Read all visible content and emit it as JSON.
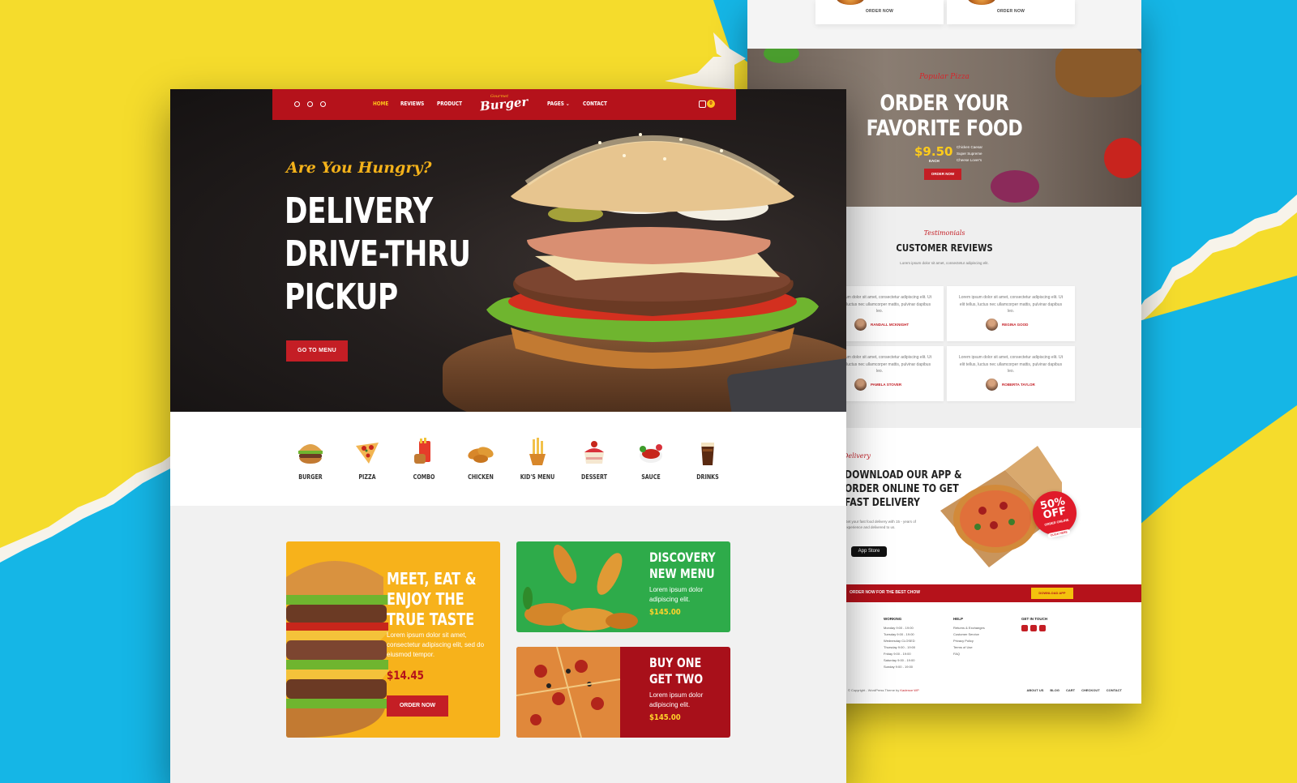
{
  "colors": {
    "brand_red": "#b5121b",
    "accent_yellow": "#ffc21a",
    "bg_yellow": "#f5dc2c",
    "bg_blue": "#15b6e6",
    "promo_yellow": "#f7b21b",
    "promo_green": "#2eab4a",
    "promo_red": "#a8101a"
  },
  "front": {
    "nav": {
      "social_icons": [
        "facebook-icon",
        "twitter-icon",
        "instagram-icon"
      ],
      "links_left": [
        "HOME",
        "REVIEWS",
        "PRODUCT"
      ],
      "links_right": [
        "PAGES",
        "CONTACT"
      ],
      "active": "HOME",
      "logo_top": "Gourmet",
      "logo_main": "Burger",
      "cart_count": "0"
    },
    "hero": {
      "kicker": "Are You Hungry?",
      "headline": [
        "DELIVERY",
        "DRIVE-THRU",
        "PICKUP"
      ],
      "button": "GO TO MENU"
    },
    "categories": [
      {
        "label": "BURGER",
        "icon": "burger-icon"
      },
      {
        "label": "PIZZA",
        "icon": "pizza-icon"
      },
      {
        "label": "COMBO",
        "icon": "combo-icon"
      },
      {
        "label": "CHICKEN",
        "icon": "chicken-icon"
      },
      {
        "label": "KID'S MENU",
        "icon": "kids-menu-icon"
      },
      {
        "label": "DESSERT",
        "icon": "dessert-icon"
      },
      {
        "label": "SAUCE",
        "icon": "sauce-icon"
      },
      {
        "label": "DRINKS",
        "icon": "drinks-icon"
      }
    ],
    "promos": {
      "yellow": {
        "title": [
          "MEET, EAT &",
          "ENJOY THE",
          "TRUE TASTE"
        ],
        "desc": "Lorem ipsum dolor sit amet, consectetur adipiscing elit, sed do eiusmod tempor.",
        "price": "$14.45",
        "button": "ORDER NOW"
      },
      "green": {
        "title": [
          "DISCOVERY",
          "NEW MENU"
        ],
        "desc": "Lorem ipsum dolor adipiscing elit.",
        "price": "$145.00"
      },
      "red": {
        "title": [
          "BUY ONE",
          "GET TWO"
        ],
        "desc": "Lorem ipsum dolor adipiscing elit.",
        "price": "$145.00"
      }
    }
  },
  "back": {
    "top_cards": [
      {
        "button": "ORDER NOW"
      },
      {
        "button": "ORDER NOW"
      }
    ],
    "order": {
      "kicker": "Popular Pizza",
      "title": [
        "ORDER YOUR",
        "FAVORITE FOOD"
      ],
      "price": "$9.50",
      "price_unit": "EACH",
      "flavours": [
        "Chicken Caesar",
        "Super Supreme",
        "Cheese Lover's"
      ],
      "button": "ORDER NOW"
    },
    "reviews": {
      "kicker": "Testimonials",
      "title": "CUSTOMER REVIEWS",
      "subtitle": "Lorem ipsum dolor sit amet, consectetur adipiscing elit.",
      "items": [
        {
          "text": "Lorem ipsum dolor sit amet, consectetur adipiscing elit. Ut elit tellus, luctus nec ullamcorper mattis, pulvinar dapibus leo.",
          "name": "RANDALL MCKNIGHT"
        },
        {
          "text": "Lorem ipsum dolor sit amet, consectetur adipiscing elit. Ut elit tellus, luctus nec ullamcorper mattis, pulvinar dapibus leo.",
          "name": "REGINA GOOD"
        },
        {
          "text": "Lorem ipsum dolor sit amet, consectetur adipiscing elit. Ut elit tellus, luctus nec ullamcorper mattis, pulvinar dapibus leo.",
          "name": "PAMELA STOVER"
        },
        {
          "text": "Lorem ipsum dolor sit amet, consectetur adipiscing elit. Ut elit tellus, luctus nec ullamcorper mattis, pulvinar dapibus leo.",
          "name": "ROBERTA TAYLOR"
        }
      ]
    },
    "app": {
      "kicker": "Delivery",
      "title": [
        "DOWNLOAD OUR APP &",
        "ORDER ONLINE TO GET",
        "FAST DELIVERY"
      ],
      "desc": "Get your fast food delivery with 15 - years of experience and delivered to us.",
      "store_badge": "App Store",
      "badge_big": "50% OFF",
      "badge_small": "ORDER ONLINE",
      "badge_pill": "CLICK HERE"
    },
    "strip": {
      "text": "ORDER NOW FOR THE BEST CHOW",
      "button": "DOWNLOAD APP"
    },
    "footer": {
      "working_heading": "WORKING",
      "working": [
        "Monday 9:00 - 19:00",
        "Tuesday 9:00 - 19:00",
        "Wednesday CLOSED",
        "Thursday 9:00 - 19:00",
        "Friday 9:00 - 19:00",
        "Saturday 9:00 - 19:00",
        "Sunday 9:00 - 19:00"
      ],
      "help_heading": "HELP",
      "help": [
        "Returns & Exchanges",
        "Customer Service",
        "Privacy Policy",
        "Terms of Use",
        "FAQ"
      ],
      "touch_heading": "GET IN TOUCH",
      "copyright": "© Copyright - WordPress Theme by",
      "copyright_author": "Kadence WP",
      "bottom_links": [
        "ABOUT US",
        "BLOG",
        "CART",
        "CHECKOUT",
        "CONTACT"
      ]
    }
  }
}
